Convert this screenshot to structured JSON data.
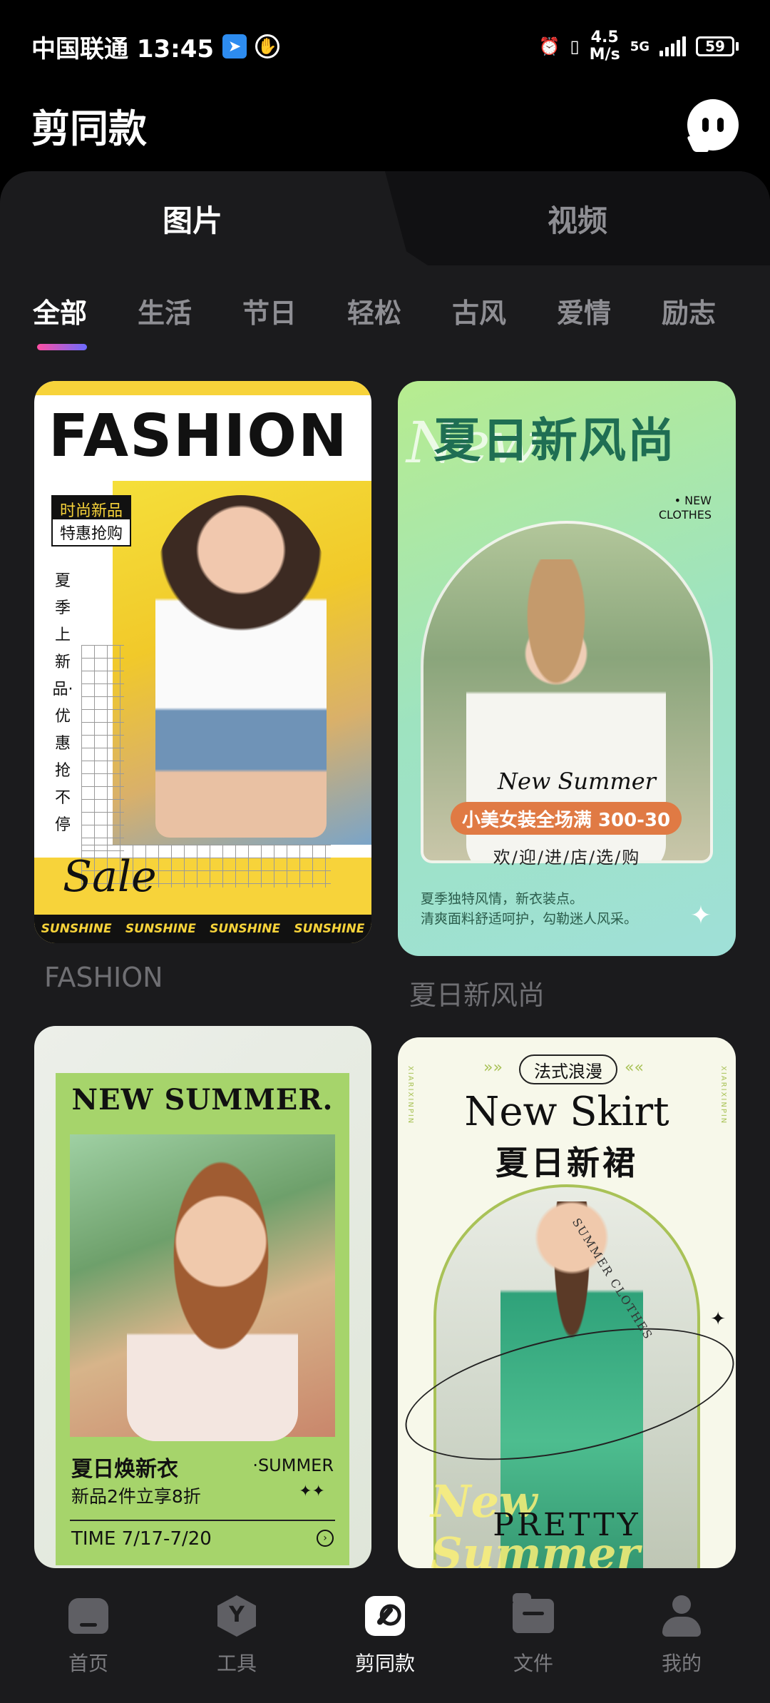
{
  "status_bar": {
    "carrier_time": "中国联通 13:45",
    "net_speed_value": "4.5",
    "net_speed_unit": "M/s",
    "network": "5G",
    "battery": "59"
  },
  "header": {
    "title": "剪同款",
    "chat_icon": "chat-bubble-icon"
  },
  "tabs": [
    {
      "label": "图片",
      "active": true
    },
    {
      "label": "视频",
      "active": false
    }
  ],
  "categories": [
    {
      "label": "全部",
      "active": true
    },
    {
      "label": "生活"
    },
    {
      "label": "节日"
    },
    {
      "label": "轻松"
    },
    {
      "label": "古风"
    },
    {
      "label": "爱情"
    },
    {
      "label": "励志"
    }
  ],
  "templates": [
    {
      "title": "FASHION",
      "headline": "FASHION",
      "tag1": "时尚新品",
      "tag2": "特惠抢购",
      "vertical_text": "夏季上新品·优惠抢不停",
      "script": "Sale",
      "footer": [
        "SUNSHINE",
        "SUNSHINE",
        "SUNSHINE",
        "SUNSHINE"
      ]
    },
    {
      "title": "夏日新风尚",
      "headline": "夏日新风尚",
      "script_bg": "New",
      "corner": "• NEW\nCLOTHES",
      "script": "New Summer",
      "promo": "小美女装全场满 300-30",
      "welcome": "欢/迎/进/店/选/购",
      "desc_line1": "夏季独特风情，新衣装点。",
      "desc_line2": "清爽面料舒适呵护，勾勒迷人风采。"
    },
    {
      "headline": "NEW SUMMER.",
      "main": "夏日焕新衣",
      "sub": "新品2件立享8折",
      "summer": "·SUMMER",
      "time": "TIME 7/17-7/20"
    },
    {
      "pill": "法式浪漫",
      "headline": "New Skirt",
      "cn": "夏日新裙",
      "circle_text": "SUMMER CLOTHES",
      "side_text": "XIARIXINPIN",
      "script": "New Summer",
      "bottom": "PRETTY"
    }
  ],
  "bottom_nav": [
    {
      "label": "首页",
      "icon": "home-icon",
      "active": false
    },
    {
      "label": "工具",
      "icon": "tools-icon",
      "active": false
    },
    {
      "label": "剪同款",
      "icon": "clip-icon",
      "active": true
    },
    {
      "label": "文件",
      "icon": "folder-icon",
      "active": false
    },
    {
      "label": "我的",
      "icon": "profile-icon",
      "active": false
    }
  ],
  "colors": {
    "background": "#000000",
    "panel": "#1b1b1d",
    "accent_gradient_start": "#ff4fa3",
    "accent_gradient_end": "#6b6bff"
  }
}
